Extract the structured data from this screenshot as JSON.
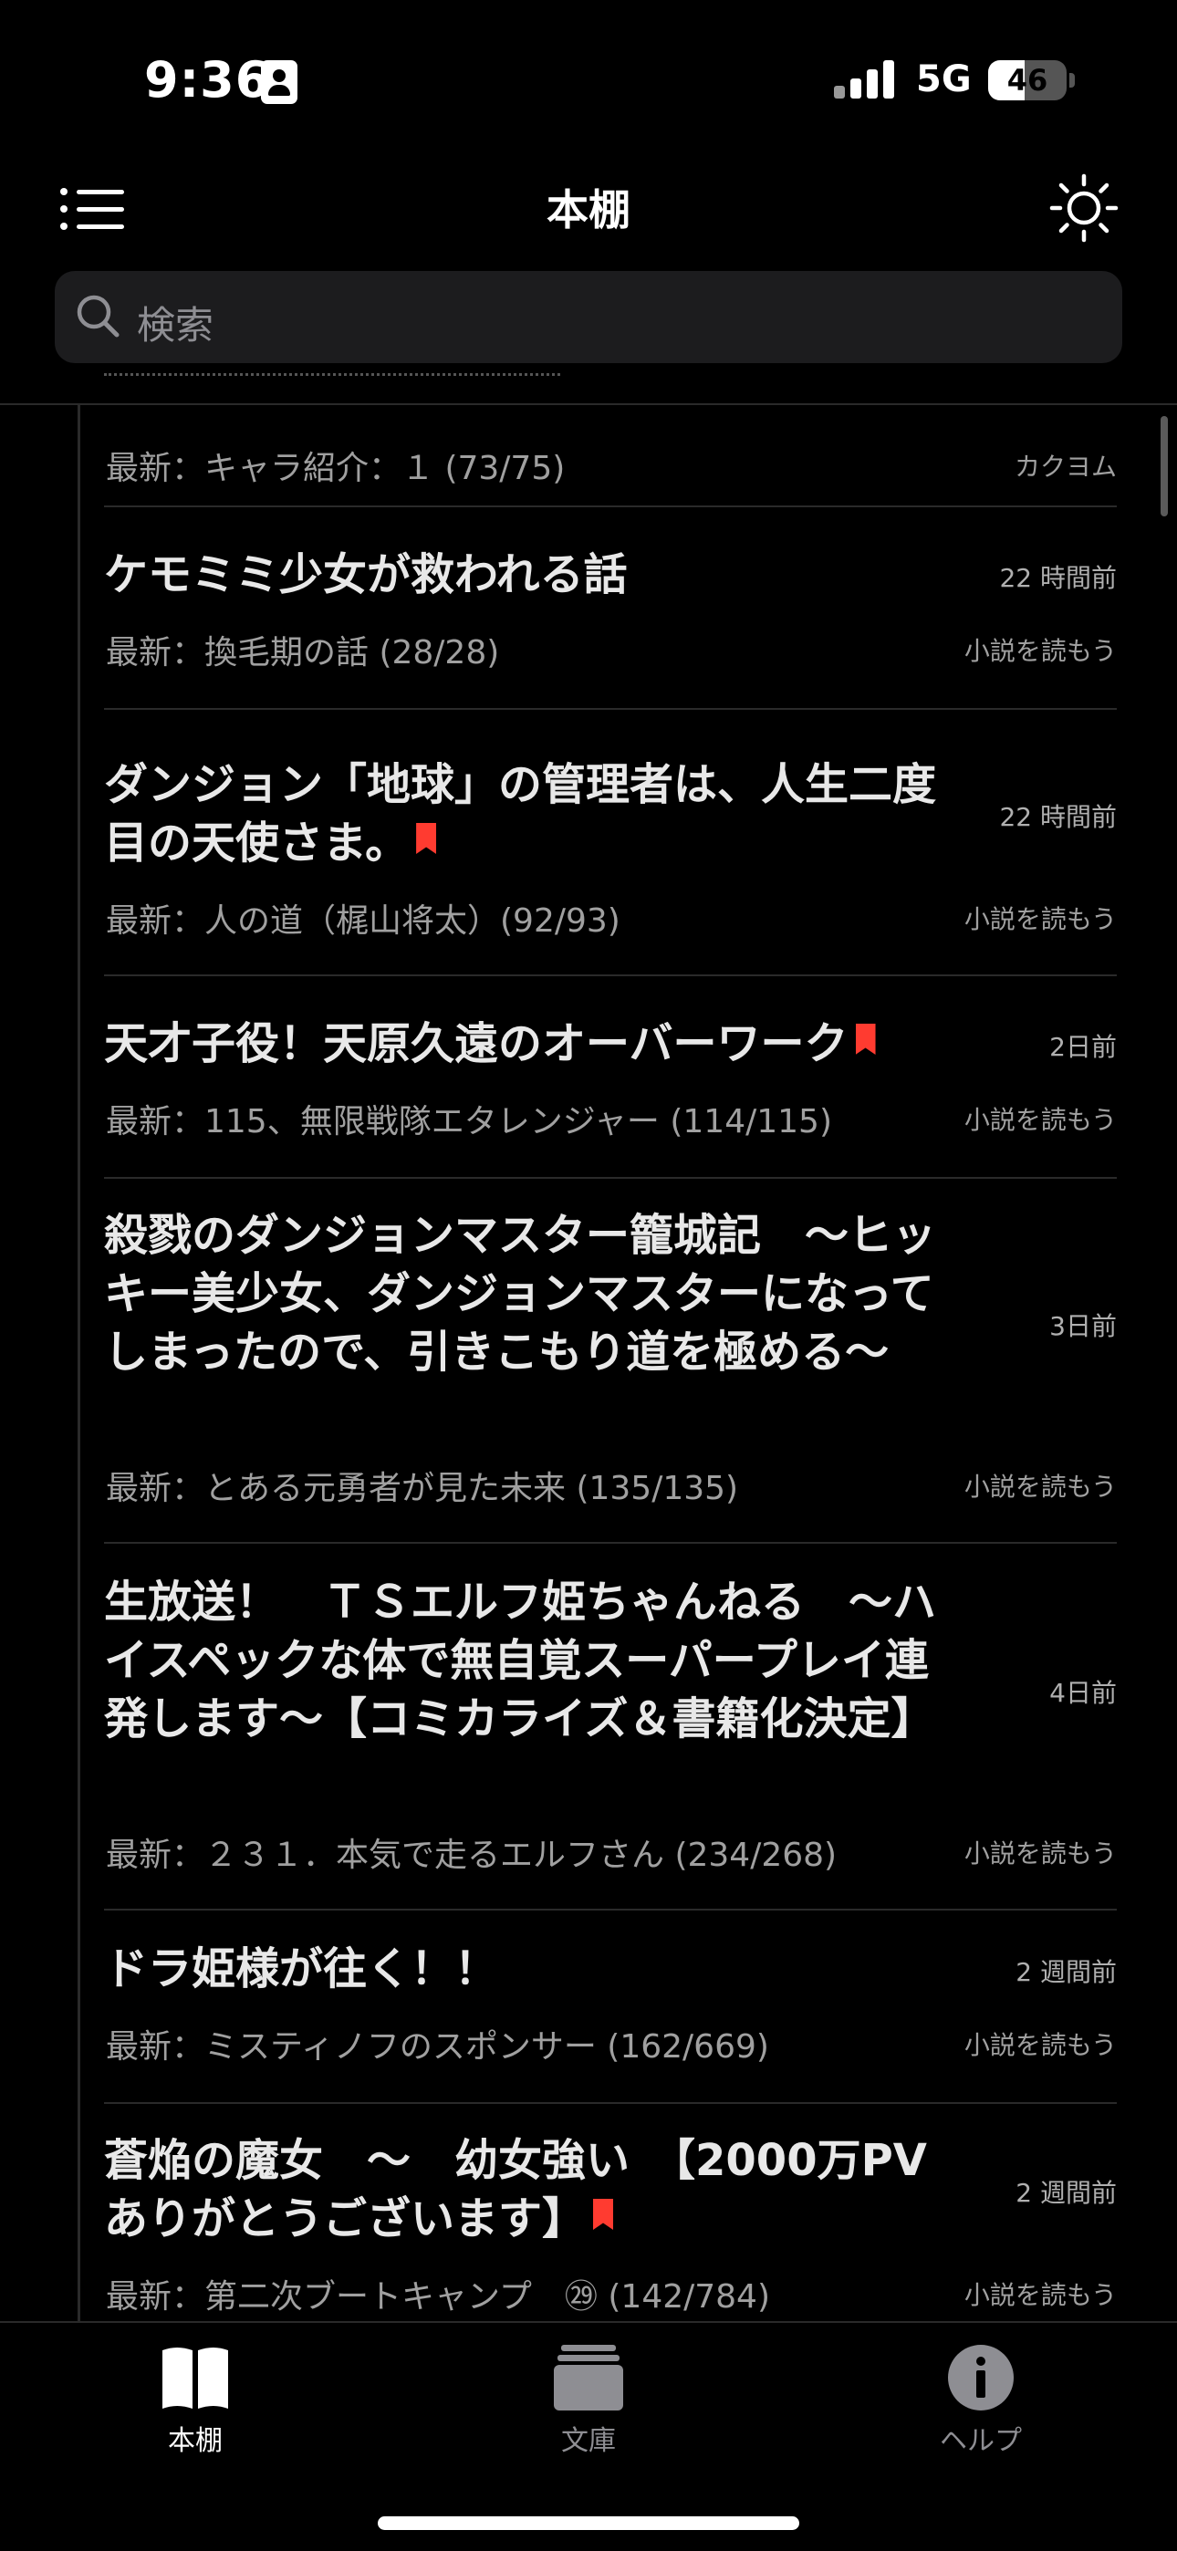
{
  "status_bar": {
    "time": "9:36",
    "network": "5G",
    "battery_percent": "46",
    "battery_level": 0.46
  },
  "nav": {
    "title": "本棚",
    "menu_icon": "list-icon",
    "theme_icon": "sun-icon"
  },
  "search": {
    "placeholder": "検索"
  },
  "partial_item": {
    "latest": "最新：キャラ紹介：１ (73/75)",
    "source": "カクヨム"
  },
  "items": [
    {
      "title": "ケモミミ少女が救われる話",
      "bookmarked": false,
      "time": "22 時間前",
      "latest": "最新：換毛期の話 (28/28)",
      "source": "小説を読もう"
    },
    {
      "title": "ダンジョン「地球」の管理者は、人生二度目の天使さま。",
      "bookmarked": true,
      "time": "22 時間前",
      "latest": "最新：人の道（梶山将太）(92/93)",
      "source": "小説を読もう"
    },
    {
      "title": "天才子役！天原久遠のオーバーワーク",
      "bookmarked": true,
      "time": "2日前",
      "latest": "最新：115、無限戦隊エタレンジャー (114/115)",
      "source": "小説を読もう"
    },
    {
      "title": "殺戮のダンジョンマスター籠城記　〜ヒッキー美少女、ダンジョンマスターになってしまったので、引きこもり道を極める〜",
      "bookmarked": false,
      "time": "3日前",
      "latest": "最新：とある元勇者が見た未来 (135/135)",
      "source": "小説を読もう"
    },
    {
      "title": "生放送！　ＴＳエルフ姫ちゃんねる　〜ハイスペックな体で無自覚スーパープレイ連発します〜【コミカライズ＆書籍化決定】",
      "bookmarked": false,
      "time": "4日前",
      "latest": "最新：２３１．本気で走るエルフさん (234/268)",
      "source": "小説を読もう"
    },
    {
      "title": "ドラ姫様が往く！！",
      "bookmarked": false,
      "time": "2 週間前",
      "latest": "最新：ミスティノフのスポンサー (162/669)",
      "source": "小説を読もう"
    },
    {
      "title": "蒼焔の魔女　〜　幼女強い　【2000万PVありがとうございます】",
      "bookmarked": true,
      "time": "2 週間前",
      "latest": "最新：第二次ブートキャンプ　㉙ (142/784)",
      "source": "小説を読もう"
    }
  ],
  "tabs": [
    {
      "label": "本棚",
      "icon": "open-book-icon",
      "active": true
    },
    {
      "label": "文庫",
      "icon": "book-stack-icon",
      "active": false
    },
    {
      "label": "ヘルプ",
      "icon": "info-icon",
      "active": false
    }
  ],
  "colors": {
    "background": "#000000",
    "bookmark": "#ff3b30",
    "tab_active": "#ffffff",
    "tab_inactive": "#8e8e93"
  }
}
